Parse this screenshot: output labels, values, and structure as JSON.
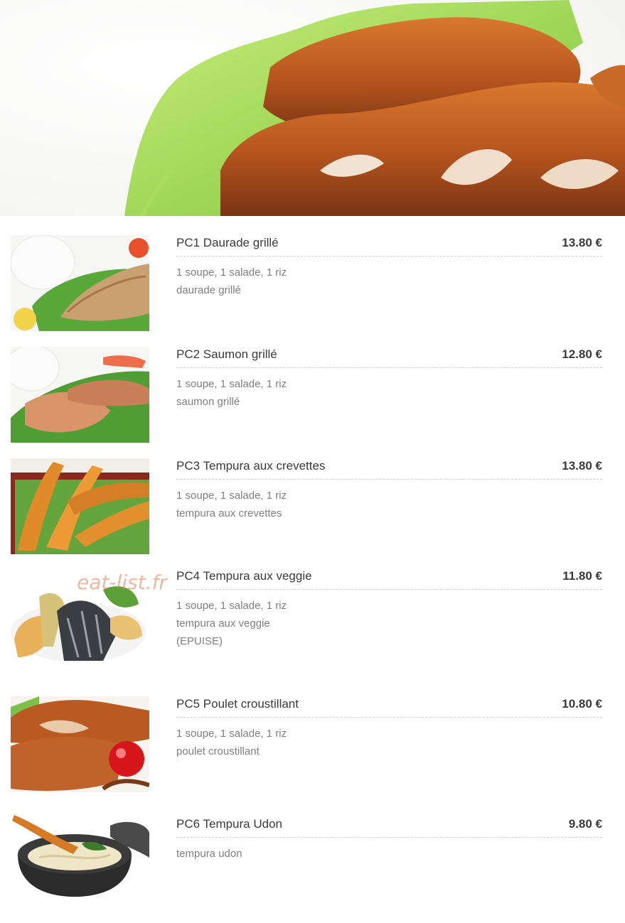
{
  "hero": {
    "image": "fried-chicken-cutlet-on-lettuce"
  },
  "watermark": "eat-list.fr",
  "items": [
    {
      "name": "PC1 Daurade grillé",
      "price": "13.80 €",
      "desc": [
        "1 soupe, 1 salade, 1 riz",
        "daurade grillé"
      ],
      "image": "grilled-sea-bream-with-rice-and-salad"
    },
    {
      "name": "PC2 Saumon grillé",
      "price": "12.80 €",
      "desc": [
        "1 soupe, 1 salade, 1 riz",
        "saumon grillé"
      ],
      "image": "grilled-salmon-with-rice-and-salad"
    },
    {
      "name": "PC3 Tempura aux crevettes",
      "price": "13.80 €",
      "desc": [
        "1 soupe, 1 salade, 1 riz",
        "tempura aux crevettes"
      ],
      "image": "shrimp-tempura"
    },
    {
      "name": "PC4 Tempura aux veggie",
      "price": "11.80 €",
      "desc": [
        "1 soupe, 1 salade, 1 riz",
        "tempura aux veggie",
        "(EPUISE)"
      ],
      "image": "vegetable-tempura"
    },
    {
      "name": "PC5 Poulet croustillant",
      "price": "10.80 €",
      "desc": [
        "1 soupe, 1 salade, 1 riz",
        "poulet croustillant"
      ],
      "image": "crispy-chicken"
    },
    {
      "name": "PC6 Tempura Udon",
      "price": "9.80 €",
      "desc": [
        "tempura udon"
      ],
      "image": "tempura-udon-bowl"
    }
  ]
}
